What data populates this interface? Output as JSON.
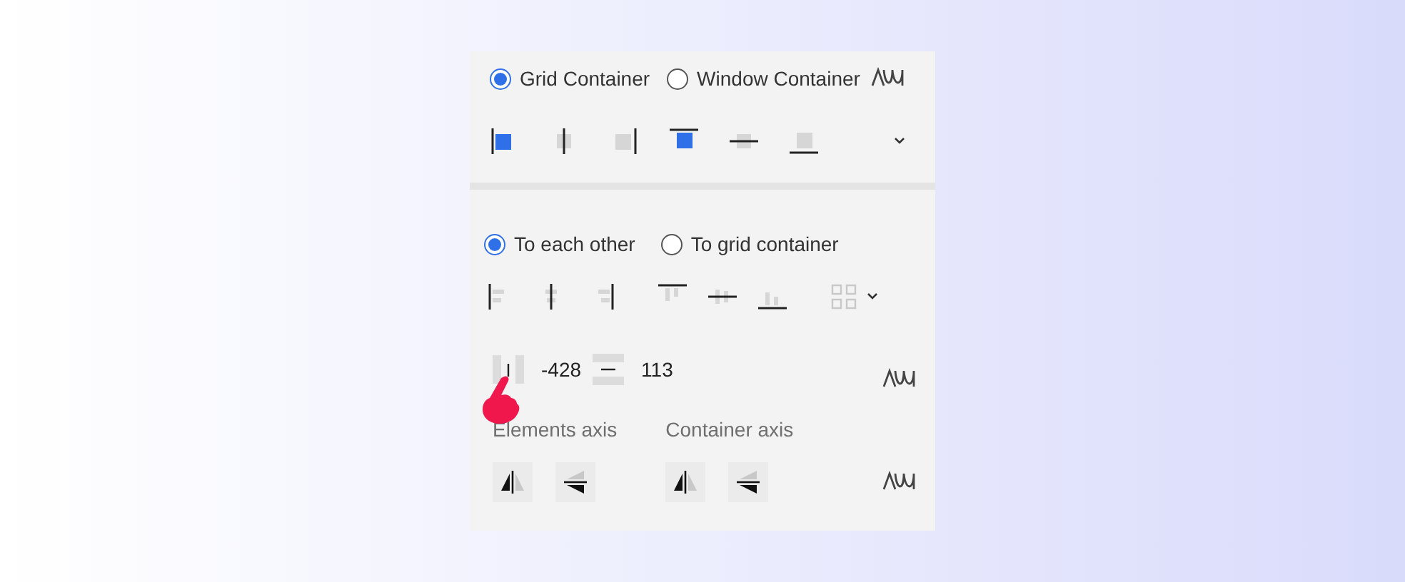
{
  "container_mode": {
    "radios": [
      {
        "label": "Grid Container",
        "selected": true
      },
      {
        "label": "Window Container",
        "selected": false
      }
    ],
    "align_buttons": [
      {
        "kind": "left",
        "active": true
      },
      {
        "kind": "hcenter",
        "active": false
      },
      {
        "kind": "right",
        "active": false
      },
      {
        "kind": "top",
        "active": true
      },
      {
        "kind": "vcenter",
        "active": false
      },
      {
        "kind": "bottom",
        "active": false
      }
    ]
  },
  "relative_to": {
    "radios": [
      {
        "label": "To each other",
        "selected": true
      },
      {
        "label": "To grid container",
        "selected": false
      }
    ],
    "align_buttons": [
      {
        "kind": "left"
      },
      {
        "kind": "hcenter"
      },
      {
        "kind": "right"
      },
      {
        "kind": "top"
      },
      {
        "kind": "vcenter"
      },
      {
        "kind": "bottom"
      }
    ]
  },
  "spacing": {
    "horizontal": "-428",
    "vertical": "113"
  },
  "flip": [
    {
      "label": "Elements axis"
    },
    {
      "label": "Container axis"
    }
  ]
}
